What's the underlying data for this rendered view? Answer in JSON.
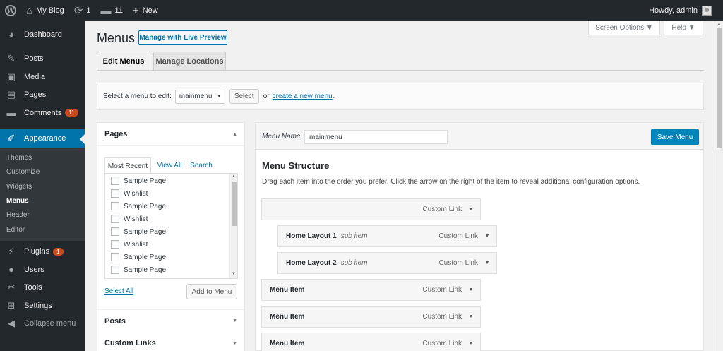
{
  "adminbar": {
    "wp_logo": "W",
    "site_name": "My Blog",
    "updates_count": "1",
    "comments_count": "11",
    "new_label": "New",
    "howdy": "Howdy, admin"
  },
  "sidebar": {
    "dashboard": "Dashboard",
    "posts": "Posts",
    "media": "Media",
    "pages": "Pages",
    "comments": "Comments",
    "comments_badge": "11",
    "appearance": "Appearance",
    "submenu": [
      "Themes",
      "Customize",
      "Widgets",
      "Menus",
      "Header",
      "Editor"
    ],
    "plugins": "Plugins",
    "plugins_badge": "1",
    "users": "Users",
    "tools": "Tools",
    "settings": "Settings",
    "collapse": "Collapse menu"
  },
  "screen": {
    "screen_options": "Screen Options ▼",
    "help": "Help ▼"
  },
  "header": {
    "title": "Menus",
    "live_preview": "Manage with Live Preview",
    "tabs": [
      "Edit Menus",
      "Manage Locations"
    ]
  },
  "select_bar": {
    "label": "Select a menu to edit:",
    "selected": "mainmenu",
    "select_button": "Select",
    "or_text": "or",
    "create_link": "create a new menu",
    "period": "."
  },
  "accordion": {
    "pages_title": "Pages",
    "inner_tabs": [
      "Most Recent",
      "View All",
      "Search"
    ],
    "items": [
      "Sample Page",
      "Wishlist",
      "Sample Page",
      "Wishlist",
      "Sample Page",
      "Wishlist",
      "Sample Page",
      "Sample Page"
    ],
    "select_all": "Select All",
    "add_to_menu": "Add to Menu",
    "posts_title": "Posts",
    "custom_links_title": "Custom Links"
  },
  "menu_edit": {
    "name_label": "Menu Name",
    "name_value": "mainmenu",
    "save_button": "Save Menu",
    "structure_title": "Menu Structure",
    "structure_desc": "Drag each item into the order you prefer. Click the arrow on the right of the item to reveal additional configuration options.",
    "items": [
      {
        "title": "",
        "sub": "",
        "type": "Custom Link"
      },
      {
        "title": "Home Layout 1",
        "sub": "sub item",
        "type": "Custom Link"
      },
      {
        "title": "Home Layout 2",
        "sub": "sub item",
        "type": "Custom Link"
      },
      {
        "title": "Menu Item",
        "sub": "",
        "type": "Custom Link"
      },
      {
        "title": "Menu Item",
        "sub": "",
        "type": "Custom Link"
      },
      {
        "title": "Menu Item",
        "sub": "",
        "type": "Custom Link"
      }
    ]
  }
}
